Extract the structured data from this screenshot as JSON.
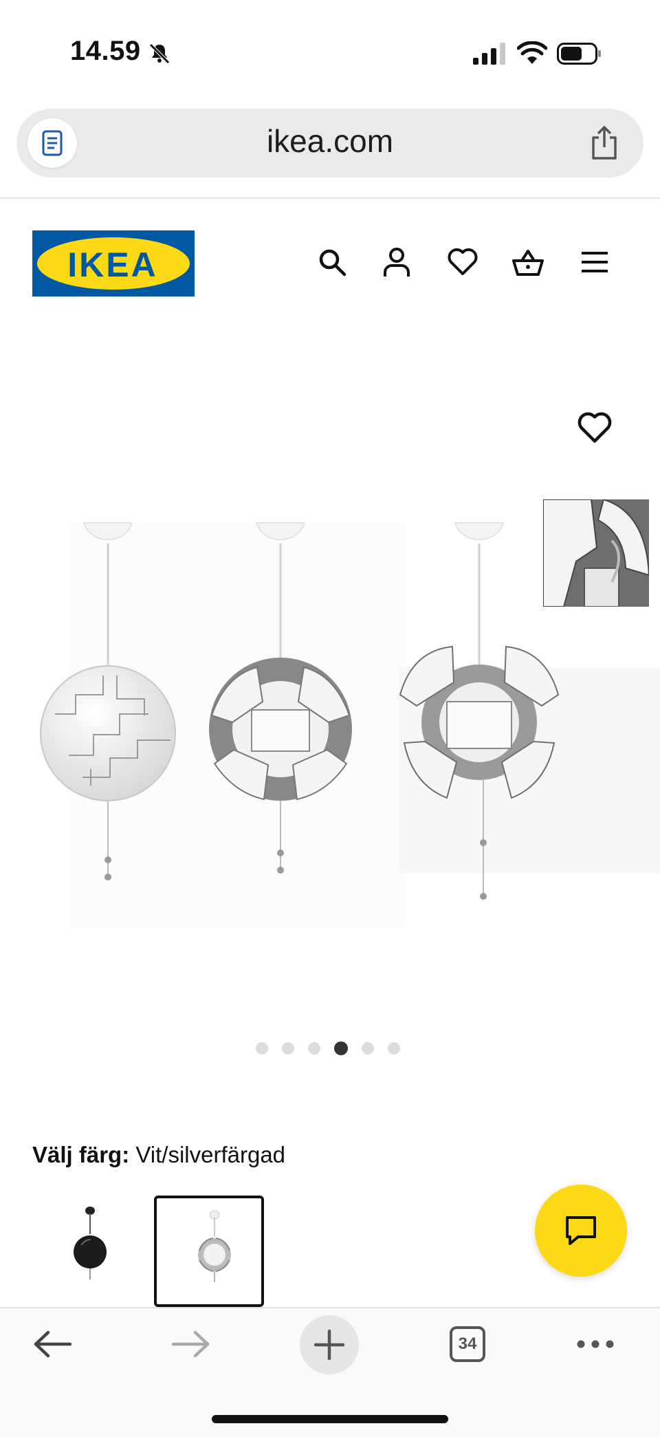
{
  "status_bar": {
    "time": "14.59"
  },
  "browser": {
    "url": "ikea.com",
    "tab_count": "34"
  },
  "header": {
    "logo_text": "IKEA"
  },
  "gallery": {
    "dot_count": 6,
    "active_index": 3
  },
  "color_picker": {
    "label": "Välj färg:",
    "selected_value": "Vit/silverfärgad"
  },
  "colors": {
    "ikea_blue": "#0058a3",
    "ikea_yellow": "#fbd914"
  }
}
